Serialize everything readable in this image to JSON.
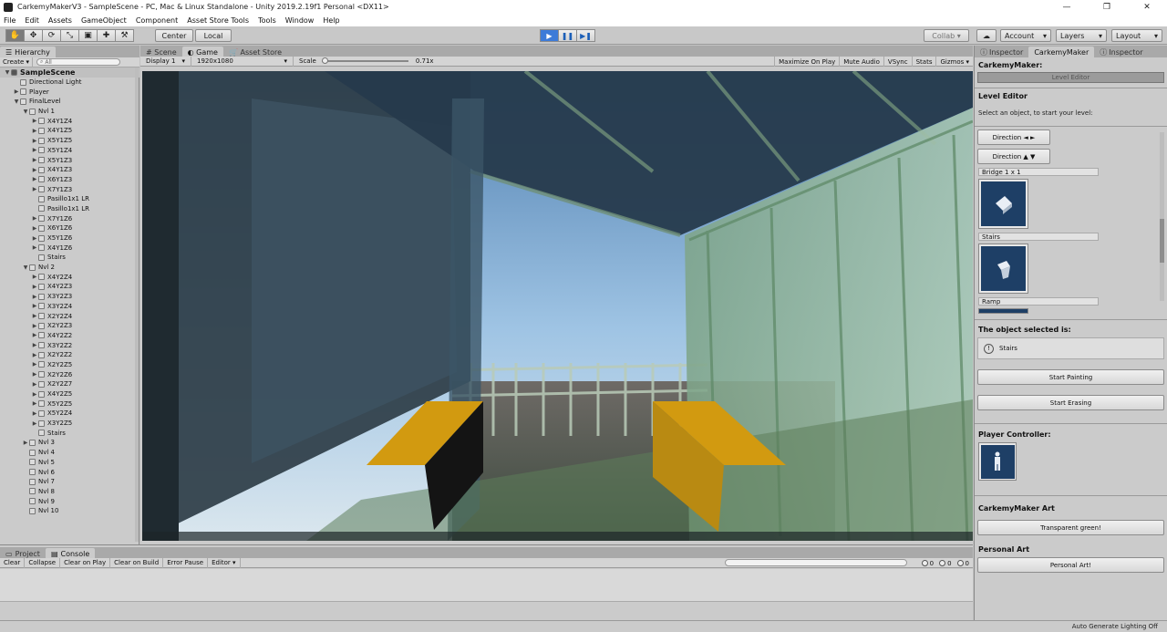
{
  "window": {
    "title": "CarkemyMakerV3 - SampleScene - PC, Mac & Linux Standalone - Unity 2019.2.19f1 Personal <DX11>",
    "controls": [
      "—",
      "❐",
      "✕"
    ]
  },
  "menu": [
    "File",
    "Edit",
    "Assets",
    "GameObject",
    "Component",
    "Asset Store Tools",
    "Tools",
    "Window",
    "Help"
  ],
  "toolbar": {
    "tools": [
      "✋",
      "✥",
      "⟳",
      "⤡",
      "▣",
      "✚",
      "⚒"
    ],
    "pivot": "Center",
    "space": "Local",
    "collab": "Collab ▾",
    "cloud": "☁",
    "account": "Account",
    "layers": "Layers",
    "layout": "Layout",
    "play": "▶",
    "pause": "❚❚",
    "step": "▶❚"
  },
  "hierarchy": {
    "tab": "Hierarchy",
    "create": "Create ▾",
    "search_placeholder": "All",
    "items": [
      {
        "label": "SampleScene",
        "depth": 0,
        "arrow": "▼",
        "scene": true
      },
      {
        "label": "Directional Light",
        "depth": 1,
        "arrow": ""
      },
      {
        "label": "Player",
        "depth": 1,
        "arrow": "▶"
      },
      {
        "label": "FinalLevel",
        "depth": 1,
        "arrow": "▼"
      },
      {
        "label": "Nvl 1",
        "depth": 2,
        "arrow": "▼"
      },
      {
        "label": "X4Y1Z4",
        "depth": 3,
        "arrow": "▶"
      },
      {
        "label": "X4Y1Z5",
        "depth": 3,
        "arrow": "▶"
      },
      {
        "label": "X5Y1Z5",
        "depth": 3,
        "arrow": "▶"
      },
      {
        "label": "X5Y1Z4",
        "depth": 3,
        "arrow": "▶"
      },
      {
        "label": "X5Y1Z3",
        "depth": 3,
        "arrow": "▶"
      },
      {
        "label": "X4Y1Z3",
        "depth": 3,
        "arrow": "▶"
      },
      {
        "label": "X6Y1Z3",
        "depth": 3,
        "arrow": "▶"
      },
      {
        "label": "X7Y1Z3",
        "depth": 3,
        "arrow": "▶"
      },
      {
        "label": "Pasillo1x1 LR",
        "depth": 3,
        "arrow": ""
      },
      {
        "label": "Pasillo1x1 LR",
        "depth": 3,
        "arrow": ""
      },
      {
        "label": "X7Y1Z6",
        "depth": 3,
        "arrow": "▶"
      },
      {
        "label": "X6Y1Z6",
        "depth": 3,
        "arrow": "▶"
      },
      {
        "label": "X5Y1Z6",
        "depth": 3,
        "arrow": "▶"
      },
      {
        "label": "X4Y1Z6",
        "depth": 3,
        "arrow": "▶"
      },
      {
        "label": "Stairs",
        "depth": 3,
        "arrow": ""
      },
      {
        "label": "Nvl 2",
        "depth": 2,
        "arrow": "▼"
      },
      {
        "label": "X4Y2Z4",
        "depth": 3,
        "arrow": "▶"
      },
      {
        "label": "X4Y2Z3",
        "depth": 3,
        "arrow": "▶"
      },
      {
        "label": "X3Y2Z3",
        "depth": 3,
        "arrow": "▶"
      },
      {
        "label": "X3Y2Z4",
        "depth": 3,
        "arrow": "▶"
      },
      {
        "label": "X2Y2Z4",
        "depth": 3,
        "arrow": "▶"
      },
      {
        "label": "X2Y2Z3",
        "depth": 3,
        "arrow": "▶"
      },
      {
        "label": "X4Y2Z2",
        "depth": 3,
        "arrow": "▶"
      },
      {
        "label": "X3Y2Z2",
        "depth": 3,
        "arrow": "▶"
      },
      {
        "label": "X2Y2Z2",
        "depth": 3,
        "arrow": "▶"
      },
      {
        "label": "X2Y2Z5",
        "depth": 3,
        "arrow": "▶"
      },
      {
        "label": "X2Y2Z6",
        "depth": 3,
        "arrow": "▶"
      },
      {
        "label": "X2Y2Z7",
        "depth": 3,
        "arrow": "▶"
      },
      {
        "label": "X4Y2Z5",
        "depth": 3,
        "arrow": "▶"
      },
      {
        "label": "X5Y2Z5",
        "depth": 3,
        "arrow": "▶"
      },
      {
        "label": "X5Y2Z4",
        "depth": 3,
        "arrow": "▶"
      },
      {
        "label": "X3Y2Z5",
        "depth": 3,
        "arrow": "▶"
      },
      {
        "label": "Stairs",
        "depth": 3,
        "arrow": ""
      },
      {
        "label": "Nvl 3",
        "depth": 2,
        "arrow": "▶"
      },
      {
        "label": "Nvl 4",
        "depth": 2,
        "arrow": ""
      },
      {
        "label": "Nvl 5",
        "depth": 2,
        "arrow": ""
      },
      {
        "label": "Nvl 6",
        "depth": 2,
        "arrow": ""
      },
      {
        "label": "Nvl 7",
        "depth": 2,
        "arrow": ""
      },
      {
        "label": "Nvl 8",
        "depth": 2,
        "arrow": ""
      },
      {
        "label": "Nvl 9",
        "depth": 2,
        "arrow": ""
      },
      {
        "label": "Nvl 10",
        "depth": 2,
        "arrow": ""
      }
    ]
  },
  "center_tabs": [
    {
      "label": "# Scene",
      "active": false
    },
    {
      "label": "◐ Game",
      "active": true
    },
    {
      "label": "🛒 Asset Store",
      "active": false
    }
  ],
  "game_controls": {
    "display": "Display 1",
    "resolution": "1920x1080",
    "scale_label": "Scale",
    "scale_value": "0.71x",
    "maximize": "Maximize On Play",
    "mute": "Mute Audio",
    "vsync": "VSync",
    "stats": "Stats",
    "gizmos": "Gizmos ▾"
  },
  "console": {
    "tabs": [
      {
        "label": "Project",
        "active": false
      },
      {
        "label": "Console",
        "active": true
      }
    ],
    "buttons": [
      "Clear",
      "Collapse",
      "Clear on Play",
      "Clear on Build",
      "Error Pause",
      "Editor ▾"
    ],
    "counts": [
      "0",
      "0",
      "0"
    ]
  },
  "inspector": {
    "tabs": [
      {
        "label": "Inspector",
        "active": false
      },
      {
        "label": "CarkemyMaker",
        "active": true
      },
      {
        "label": "Inspector",
        "active": false
      }
    ],
    "header": "CarkemyMaker:",
    "level_editor_button": "Level Editor",
    "level_editor_title": "Level Editor",
    "level_editor_hint": "Select an object, to start your level:",
    "direction_h": "Direction ◄ ►",
    "direction_v": "Direction ▲ ▼",
    "palette": [
      "Bridge 1 x 1",
      "Stairs",
      "Ramp"
    ],
    "selected_title": "The object selected is:",
    "selected_value": "Stairs",
    "start_painting": "Start Painting",
    "start_erasing": "Start Erasing",
    "player_controller_title": "Player Controller:",
    "art_title": "CarkemyMaker Art",
    "art_button": "Transparent green!",
    "personal_title": "Personal Art",
    "personal_button": "Personal Art!"
  },
  "status": {
    "right": "Auto Generate Lighting Off"
  }
}
